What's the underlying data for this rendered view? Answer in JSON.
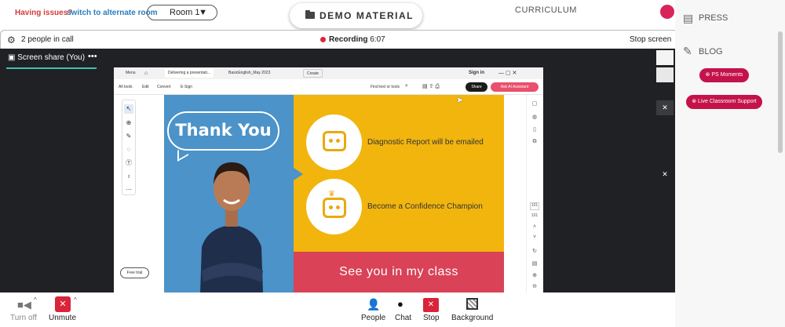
{
  "topbar": {
    "issues_text": "Having issues?",
    "switch_link": "switch to alternate room",
    "room_select": "Room 1",
    "demo_button": "DEMO MATERIAL",
    "curriculum_tab": "CURRICULUM"
  },
  "call": {
    "people_count": "2 people in call",
    "recording_label": "Recording",
    "recording_time": "6:07",
    "stop_screen": "Stop screen",
    "screen_share_title": "Screen share (You)"
  },
  "shared_window": {
    "tabs": [
      "Menu",
      "Delivering a presentati...",
      "BasicEnglish_May 2023",
      "Create"
    ],
    "signin": "Sign in",
    "menus": [
      "All tools",
      "Edit",
      "Convert",
      "E-Sign"
    ],
    "find_text": "Find text or tools",
    "share_label": "Share",
    "ai_label": "Ask AI Assistant",
    "free_trial": "Free trial",
    "page_numbers": [
      "101",
      "101"
    ]
  },
  "slide": {
    "thank_you": "Thank You",
    "item1": "Diagnostic Report will be emailed",
    "item2": "Become a Confidence Champion",
    "see_you": "See you in my class",
    "colors": {
      "blue": "#4b93c8",
      "yellow": "#f1b50e",
      "red": "#d94257"
    }
  },
  "bottom": {
    "turn_off": "Turn off",
    "unmute": "Unmute",
    "people": "People",
    "chat": "Chat",
    "stop": "Stop",
    "background": "Background"
  },
  "right_panel": {
    "press": "PRESS",
    "blog": "BLOG",
    "ps_moments": "PS Moments",
    "live_support": "Live Classroom Support"
  }
}
